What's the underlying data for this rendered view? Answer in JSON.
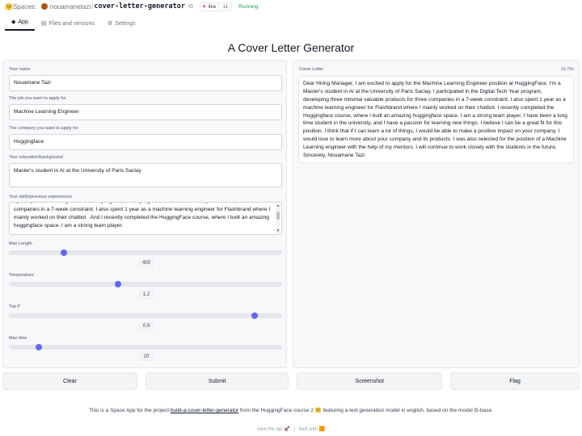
{
  "header": {
    "spaces_label": "Spaces:",
    "owner": "nouamanetazi",
    "repo": "cover-letter-generator",
    "like_label": "like",
    "like_count": "11",
    "status": "Running",
    "tabs": [
      {
        "label": "App",
        "icon": "app-icon"
      },
      {
        "label": "Files and versions",
        "icon": "files-icon"
      },
      {
        "label": "Settings",
        "icon": "gear-icon"
      }
    ]
  },
  "title": "A Cover Letter Generator",
  "inputs": {
    "name_label": "Your name",
    "name_value": "Nouamane Tazi",
    "job_label": "The job you want to apply for",
    "job_value": "Machine Learning Engineer",
    "company_label": "The company you want to apply for",
    "company_value": "Huggingface",
    "education_label": "Your education/background",
    "education_value": "Master's student in AI at the University of Paris Saclay",
    "skills_label": "Your skills/previous experiences",
    "skills_value": "I participated in the Digital Tech Year program, developing three minimal valuable products for three companies in a 7-week constraint. I also spent 1 year as a machine learning engineer for Flashbrand where I mainly worked on their chatbot . And I recently completed the HuggingFace course, where I built an amazing huggingface space. I am a strong team player."
  },
  "sliders": [
    {
      "label": "Max Length",
      "value": "400",
      "fraction": 0.2
    },
    {
      "label": "Temperature",
      "value": "1.2",
      "fraction": 0.4
    },
    {
      "label": "Top P",
      "value": "0.9",
      "fraction": 0.9
    },
    {
      "label": "Max time",
      "value": "20",
      "fraction": 0.11
    }
  ],
  "output": {
    "label": "Cover Letter",
    "time": "19.78s",
    "text": "Dear Hiring Manager, I am excited to apply for the Machine Learning Engineer position at HuggingFace. I'm a Master's student in AI at the University of Paris Saclay. I participated in the Digital Tech Year program, developing three minimal valuable products for three companies in a 7-week constraint. I also spent 1 year as a machine learning engineer for Flashbrand where I mainly worked on their chatbot. I recently completed the Huggingface course, where I built an amazing huggingface space. I am a strong team player. I have been a long time student in the university, and I have a passion for learning new things. I believe I can be a great fit for this position. I think that if I can learn a lot of things, I would be able to make a positive impact on your company. I would love to learn more about your company and its products. I was also selected for the position of a Machine Learning engineer with the help of my mentors. I will continue to work closely with the students in the future. Sincerely, Nouamane Tazi"
  },
  "buttons": {
    "clear": "Clear",
    "submit": "Submit",
    "screenshot": "Screenshot",
    "flag": "Flag"
  },
  "footer": {
    "desc_before": "This is a Space App for the project ",
    "desc_link": "build-a-cover-letter-generator",
    "desc_after": " from the HuggingFace course 2 🤗 featuring a text generation model in english, based on the model t5-base.",
    "api_label": "view the api",
    "api_icon": "🚀",
    "sep": "|",
    "built_with": "built with",
    "built_icon": "🟧"
  }
}
